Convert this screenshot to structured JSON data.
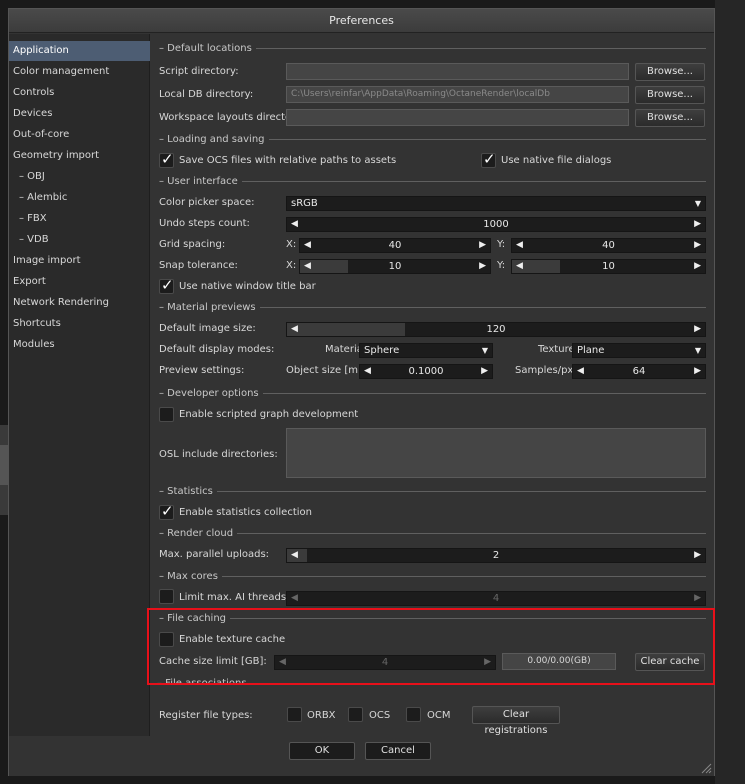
{
  "window": {
    "title": "Preferences"
  },
  "sidebar": {
    "items": [
      {
        "label": "Application"
      },
      {
        "label": "Color management"
      },
      {
        "label": "Controls"
      },
      {
        "label": "Devices"
      },
      {
        "label": "Out-of-core"
      },
      {
        "label": "Geometry import"
      },
      {
        "label": "– OBJ"
      },
      {
        "label": "– Alembic"
      },
      {
        "label": "– FBX"
      },
      {
        "label": "– VDB"
      },
      {
        "label": "Image import"
      },
      {
        "label": "Export"
      },
      {
        "label": "Network Rendering"
      },
      {
        "label": "Shortcuts"
      },
      {
        "label": "Modules"
      }
    ]
  },
  "sections": {
    "default_locations": "– Default locations",
    "loading_saving": "– Loading and saving",
    "user_interface": "– User interface",
    "material_previews": "– Material previews",
    "developer_options": "– Developer options",
    "statistics": "– Statistics",
    "render_cloud": "– Render cloud",
    "max_cores": "– Max cores",
    "file_caching": "– File caching",
    "file_associations": "– File associations"
  },
  "locations": {
    "script_label": "Script directory:",
    "script_value": "",
    "localdb_label": "Local DB directory:",
    "localdb_value": "C:\\Users\\reinfar\\AppData\\Roaming\\OctaneRender\\localDb",
    "workspace_label": "Workspace layouts directory:",
    "workspace_value": "",
    "browse": "Browse..."
  },
  "loading": {
    "save_ocs": "Save OCS files with relative paths to assets",
    "native_dialogs": "Use native file dialogs"
  },
  "ui": {
    "color_picker_label": "Color picker space:",
    "color_picker_value": "sRGB",
    "undo_label": "Undo steps count:",
    "undo_value": "1000",
    "grid_label": "Grid spacing:",
    "grid_x": "40",
    "grid_y": "40",
    "snap_label": "Snap tolerance:",
    "snap_x": "10",
    "snap_y": "10",
    "x": "X:",
    "y": "Y:",
    "native_title": "Use native window title bar"
  },
  "material": {
    "image_size_label": "Default image size:",
    "image_size_value": "120",
    "display_modes_label": "Default display modes:",
    "material_label": "Material:",
    "material_value": "Sphere",
    "texture_label": "Texture:",
    "texture_value": "Plane",
    "preview_label": "Preview settings:",
    "object_size_label": "Object size [m]:",
    "object_size_value": "0.1000",
    "samples_label": "Samples/px:",
    "samples_value": "64"
  },
  "developer": {
    "scripted_graph": "Enable scripted graph development",
    "osl_label": "OSL include directories:",
    "osl_value": ""
  },
  "statistics": {
    "enable": "Enable statistics collection"
  },
  "cloud": {
    "uploads_label": "Max. parallel uploads:",
    "uploads_value": "2"
  },
  "cores": {
    "limit_label": "Limit max. AI threads:",
    "limit_value": "4"
  },
  "caching": {
    "enable_texture": "Enable texture cache",
    "size_label": "Cache size limit [GB]:",
    "size_value": "4",
    "usage": "0.00/0.00(GB)",
    "clear": "Clear cache"
  },
  "associations": {
    "register_label": "Register file types:",
    "orbx": "ORBX",
    "ocs": "OCS",
    "ocm": "OCM",
    "clear_reg": "Clear registrations"
  },
  "footer": {
    "ok": "OK",
    "cancel": "Cancel"
  },
  "colors": {
    "selection": "#4d5d73",
    "highlight": "#e8101a"
  }
}
